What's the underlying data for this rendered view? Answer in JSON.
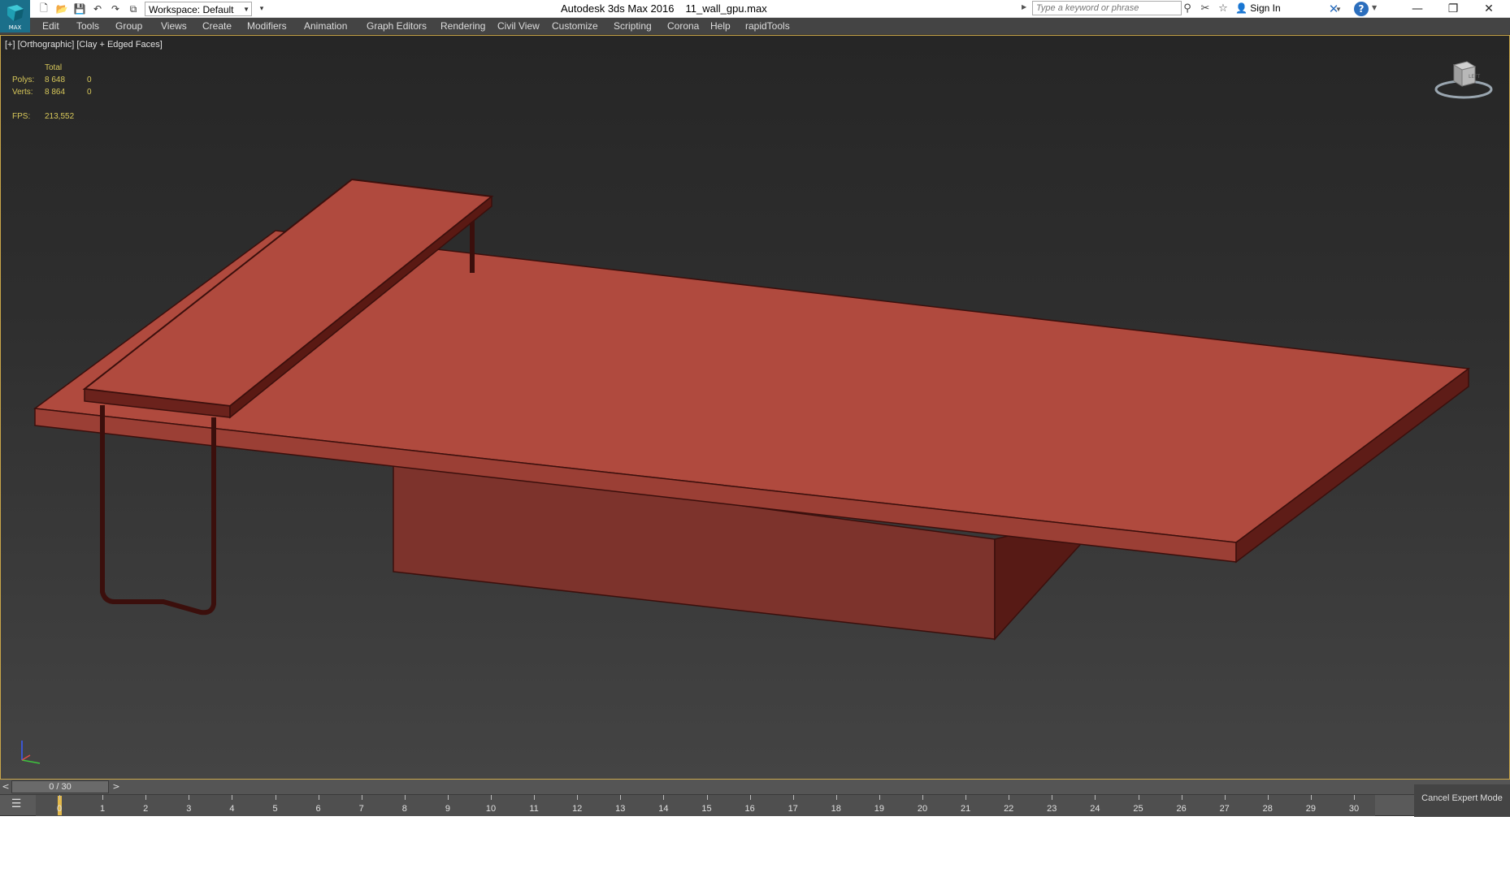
{
  "app": {
    "logo_label": "MAX",
    "title": "Autodesk 3ds Max 2016",
    "file_name": "11_wall_gpu.max"
  },
  "toolbar": {
    "workspace_label": "Workspace: Default"
  },
  "search": {
    "placeholder": "Type a keyword or phrase"
  },
  "account": {
    "sign_in_label": "Sign In"
  },
  "menu": [
    "Edit",
    "Tools",
    "Group",
    "Views",
    "Create",
    "Modifiers",
    "Animation",
    "Graph Editors",
    "Rendering",
    "Civil View",
    "Customize",
    "Scripting",
    "Corona",
    "Help",
    "rapidTools"
  ],
  "viewport": {
    "label": "[+] [Orthographic] [Clay + Edged Faces]",
    "stats": {
      "header": "Total",
      "polys_label": "Polys:",
      "polys_value": "8 648",
      "polys_selected": "0",
      "verts_label": "Verts:",
      "verts_value": "8 864",
      "verts_selected": "0",
      "fps_label": "FPS:",
      "fps_value": "213,552"
    },
    "viewcube_label": "LEFT",
    "colors": {
      "clay_top": "#b04a3e",
      "clay_side": "#7a2e28",
      "edge": "#3b0f0c"
    }
  },
  "timeline": {
    "prev": "<",
    "next": ">",
    "frame_display": "0 / 30",
    "ticks": [
      "0",
      "1",
      "2",
      "3",
      "4",
      "5",
      "6",
      "7",
      "8",
      "9",
      "10",
      "11",
      "12",
      "13",
      "14",
      "15",
      "16",
      "17",
      "18",
      "19",
      "20",
      "21",
      "22",
      "23",
      "24",
      "25",
      "26",
      "27",
      "28",
      "29",
      "30"
    ],
    "current_frame": 0
  },
  "status": {
    "cancel_expert_label": "Cancel Expert Mode"
  },
  "window": {
    "minimize": "—",
    "restore": "❐",
    "close": "✕"
  }
}
